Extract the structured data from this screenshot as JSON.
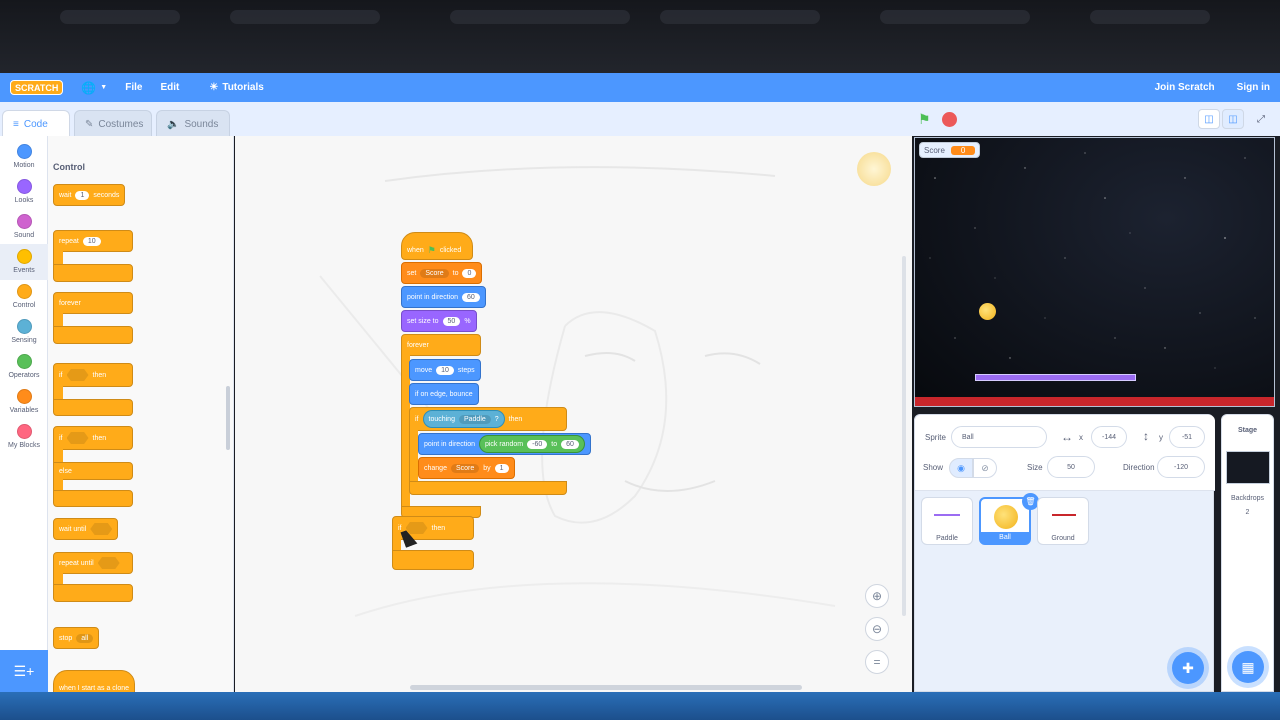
{
  "menubar": {
    "logo": "SCRATCH",
    "file": "File",
    "edit": "Edit",
    "tutorials": "Tutorials",
    "join": "Join Scratch",
    "signin": "Sign in"
  },
  "tabs": {
    "code": "Code",
    "costumes": "Costumes",
    "sounds": "Sounds"
  },
  "categories": [
    {
      "label": "Motion",
      "color": "#4c97ff"
    },
    {
      "label": "Looks",
      "color": "#9966ff"
    },
    {
      "label": "Sound",
      "color": "#cf63cf"
    },
    {
      "label": "Events",
      "color": "#ffbf00"
    },
    {
      "label": "Control",
      "color": "#ffab19"
    },
    {
      "label": "Sensing",
      "color": "#5cb1d6"
    },
    {
      "label": "Operators",
      "color": "#59c059"
    },
    {
      "label": "Variables",
      "color": "#ff8c1a"
    },
    {
      "label": "My Blocks",
      "color": "#ff6680"
    }
  ],
  "palette": {
    "title": "Control",
    "wait": {
      "label": "wait",
      "value": "1",
      "unit": "seconds"
    },
    "repeat": {
      "label": "repeat",
      "value": "10"
    },
    "forever": "forever",
    "if_then": {
      "if": "if",
      "then": "then"
    },
    "if_else": {
      "if": "if",
      "then": "then",
      "else": "else"
    },
    "wait_until": "wait until",
    "repeat_until": "repeat until",
    "stop": {
      "label": "stop",
      "option": "all"
    },
    "when_start": "when I start as a clone"
  },
  "script": {
    "when_flag": {
      "when": "when",
      "clicked": "clicked"
    },
    "set": {
      "label": "set",
      "var": "Score",
      "to": "to",
      "value": "0"
    },
    "point_dir": {
      "label": "point in direction",
      "value": "60"
    },
    "set_size": {
      "label": "set size to",
      "value": "50",
      "unit": "%"
    },
    "forever": "forever",
    "move": {
      "label": "move",
      "value": "10",
      "unit": "steps"
    },
    "bounce": "if on edge, bounce",
    "if_touch": {
      "if": "if",
      "touching": "touching",
      "target": "Paddle",
      "q": "?",
      "then": "then"
    },
    "point_random": {
      "label": "point in direction",
      "pick": "pick random",
      "from": "-60",
      "to": "to",
      "to_value": "60"
    },
    "change": {
      "label": "change",
      "var": "Score",
      "by": "by",
      "value": "1"
    },
    "loose_if": {
      "if": "if",
      "then": "then"
    }
  },
  "stage": {
    "monitor_label": "Score",
    "monitor_value": "0"
  },
  "sprite_info": {
    "sprite_label": "Sprite",
    "sprite_name": "Ball",
    "x_label": "x",
    "x_value": "-144",
    "y_label": "y",
    "y_value": "-51",
    "show_label": "Show",
    "size_label": "Size",
    "size_value": "50",
    "direction_label": "Direction",
    "direction_value": "-120"
  },
  "sprites": [
    {
      "name": "Paddle"
    },
    {
      "name": "Ball"
    },
    {
      "name": "Ground"
    }
  ],
  "stage_pane": {
    "title": "Stage",
    "backdrops_label": "Backdrops",
    "backdrops_count": "2"
  },
  "colors": {
    "accent": "#4c97ff",
    "control": "#ffab19",
    "stage_bg": "#07090d",
    "paddle": "#9b6cf2",
    "ground": "#c8262b"
  }
}
